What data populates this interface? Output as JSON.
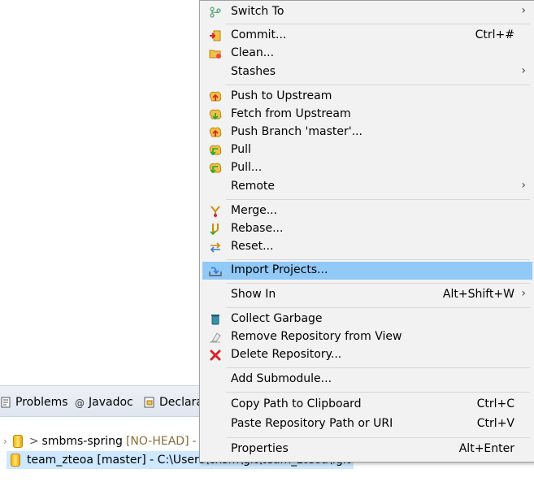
{
  "menu": {
    "items": [
      {
        "label": "Switch To",
        "accel": "",
        "submenu": "›"
      },
      {
        "label": "Commit...",
        "accel": "Ctrl+#",
        "submenu": ""
      },
      {
        "label": "Clean...",
        "accel": "",
        "submenu": ""
      },
      {
        "label": "Stashes",
        "accel": "",
        "submenu": "›"
      },
      {
        "label": "Push to Upstream",
        "accel": "",
        "submenu": ""
      },
      {
        "label": "Fetch from Upstream",
        "accel": "",
        "submenu": ""
      },
      {
        "label": "Push Branch 'master'...",
        "accel": "",
        "submenu": ""
      },
      {
        "label": "Pull",
        "accel": "",
        "submenu": ""
      },
      {
        "label": "Pull...",
        "accel": "",
        "submenu": ""
      },
      {
        "label": "Remote",
        "accel": "",
        "submenu": "›"
      },
      {
        "label": "Merge...",
        "accel": "",
        "submenu": ""
      },
      {
        "label": "Rebase...",
        "accel": "",
        "submenu": ""
      },
      {
        "label": "Reset...",
        "accel": "",
        "submenu": ""
      },
      {
        "label": "Import Projects...",
        "accel": "",
        "submenu": ""
      },
      {
        "label": "Show In",
        "accel": "Alt+Shift+W",
        "submenu": "›"
      },
      {
        "label": "Collect Garbage",
        "accel": "",
        "submenu": ""
      },
      {
        "label": "Remove Repository from View",
        "accel": "",
        "submenu": ""
      },
      {
        "label": "Delete Repository...",
        "accel": "",
        "submenu": ""
      },
      {
        "label": "Add Submodule...",
        "accel": "",
        "submenu": ""
      },
      {
        "label": "Copy Path to Clipboard",
        "accel": "Ctrl+C",
        "submenu": ""
      },
      {
        "label": "Paste Repository Path or URI",
        "accel": "Ctrl+V",
        "submenu": ""
      },
      {
        "label": "Properties",
        "accel": "Alt+Enter",
        "submenu": ""
      }
    ],
    "highlighted": "Import Projects..."
  },
  "tabs": [
    {
      "label": "Problems"
    },
    {
      "label": "Javadoc"
    },
    {
      "label": "Declara"
    }
  ],
  "tree": {
    "row1": {
      "prefix": ">",
      "name": "smbms-spring",
      "state": "[NO-HEAD]",
      "tail": "-"
    },
    "row2": {
      "text": "team_zteoa [master] - C:\\Users\\chsm\\git\\team_zteoa\\.git"
    }
  },
  "colors": {
    "highlight": "#91c9f7",
    "menu_bg": "#f2f2f2",
    "selection": "#cde8ff"
  }
}
